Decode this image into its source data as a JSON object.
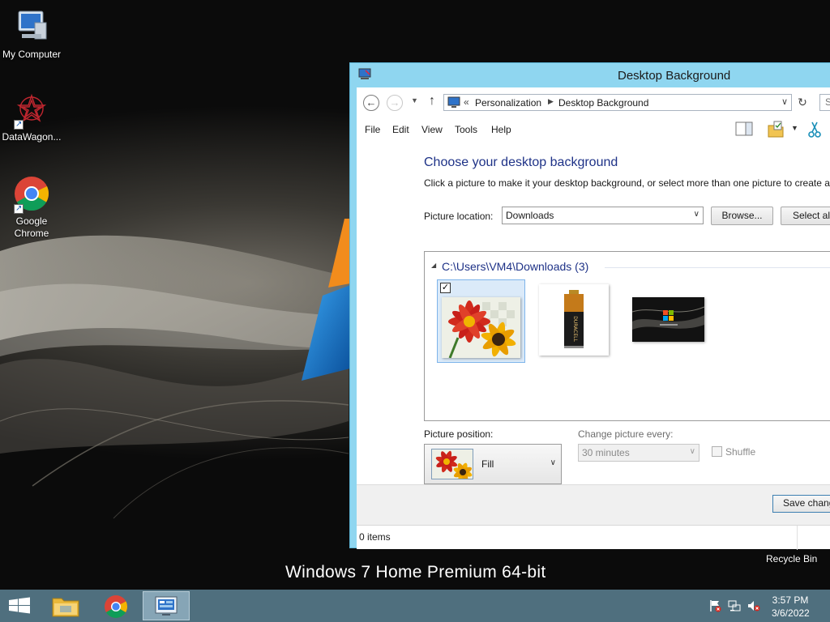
{
  "desktop": {
    "icons": [
      {
        "name": "my-computer",
        "label": "My Computer"
      },
      {
        "name": "datawagon",
        "label": "DataWagon..."
      },
      {
        "name": "google-chrome",
        "label": "Google Chrome"
      }
    ],
    "watermark": "Windows 7 Home Premium 64-bit",
    "recycle_bin_label": "Recycle Bin"
  },
  "window": {
    "title": "Desktop Background",
    "address": {
      "lead": "«",
      "crumbs": [
        "Personalization",
        "Desktop Background"
      ],
      "search_stub": "S"
    },
    "menu": [
      "File",
      "Edit",
      "View",
      "Tools",
      "Help"
    ],
    "heading": "Choose your desktop background",
    "subtext": "Click a picture to make it your desktop background, or select more than one picture to create a",
    "picture_location_label": "Picture location:",
    "picture_location_value": "Downloads",
    "browse_label": "Browse...",
    "select_all_label": "Select all",
    "group_header": "C:\\Users\\VM4\\Downloads (3)",
    "thumbnails": [
      {
        "name": "flowers",
        "selected": true,
        "checked": "✓"
      },
      {
        "name": "duracell-battery",
        "selected": false,
        "brand": "DURACELL"
      },
      {
        "name": "windows-logo-dark",
        "selected": false
      }
    ],
    "picture_position_label": "Picture position:",
    "picture_position_value": "Fill",
    "change_picture_label": "Change picture every:",
    "change_picture_value": "30 minutes",
    "shuffle_label": "Shuffle",
    "save_button": "Save changes",
    "status": "0 items"
  },
  "taskbar": {
    "items": [
      "start",
      "file-explorer",
      "chrome",
      "personalization"
    ],
    "active": "personalization",
    "clock_time": "3:57 PM",
    "clock_date": "3/6/2022",
    "colors": {
      "taskbar": "#4f6f7e",
      "window_frame": "#8fd6f0",
      "heading": "#1e3287"
    }
  }
}
